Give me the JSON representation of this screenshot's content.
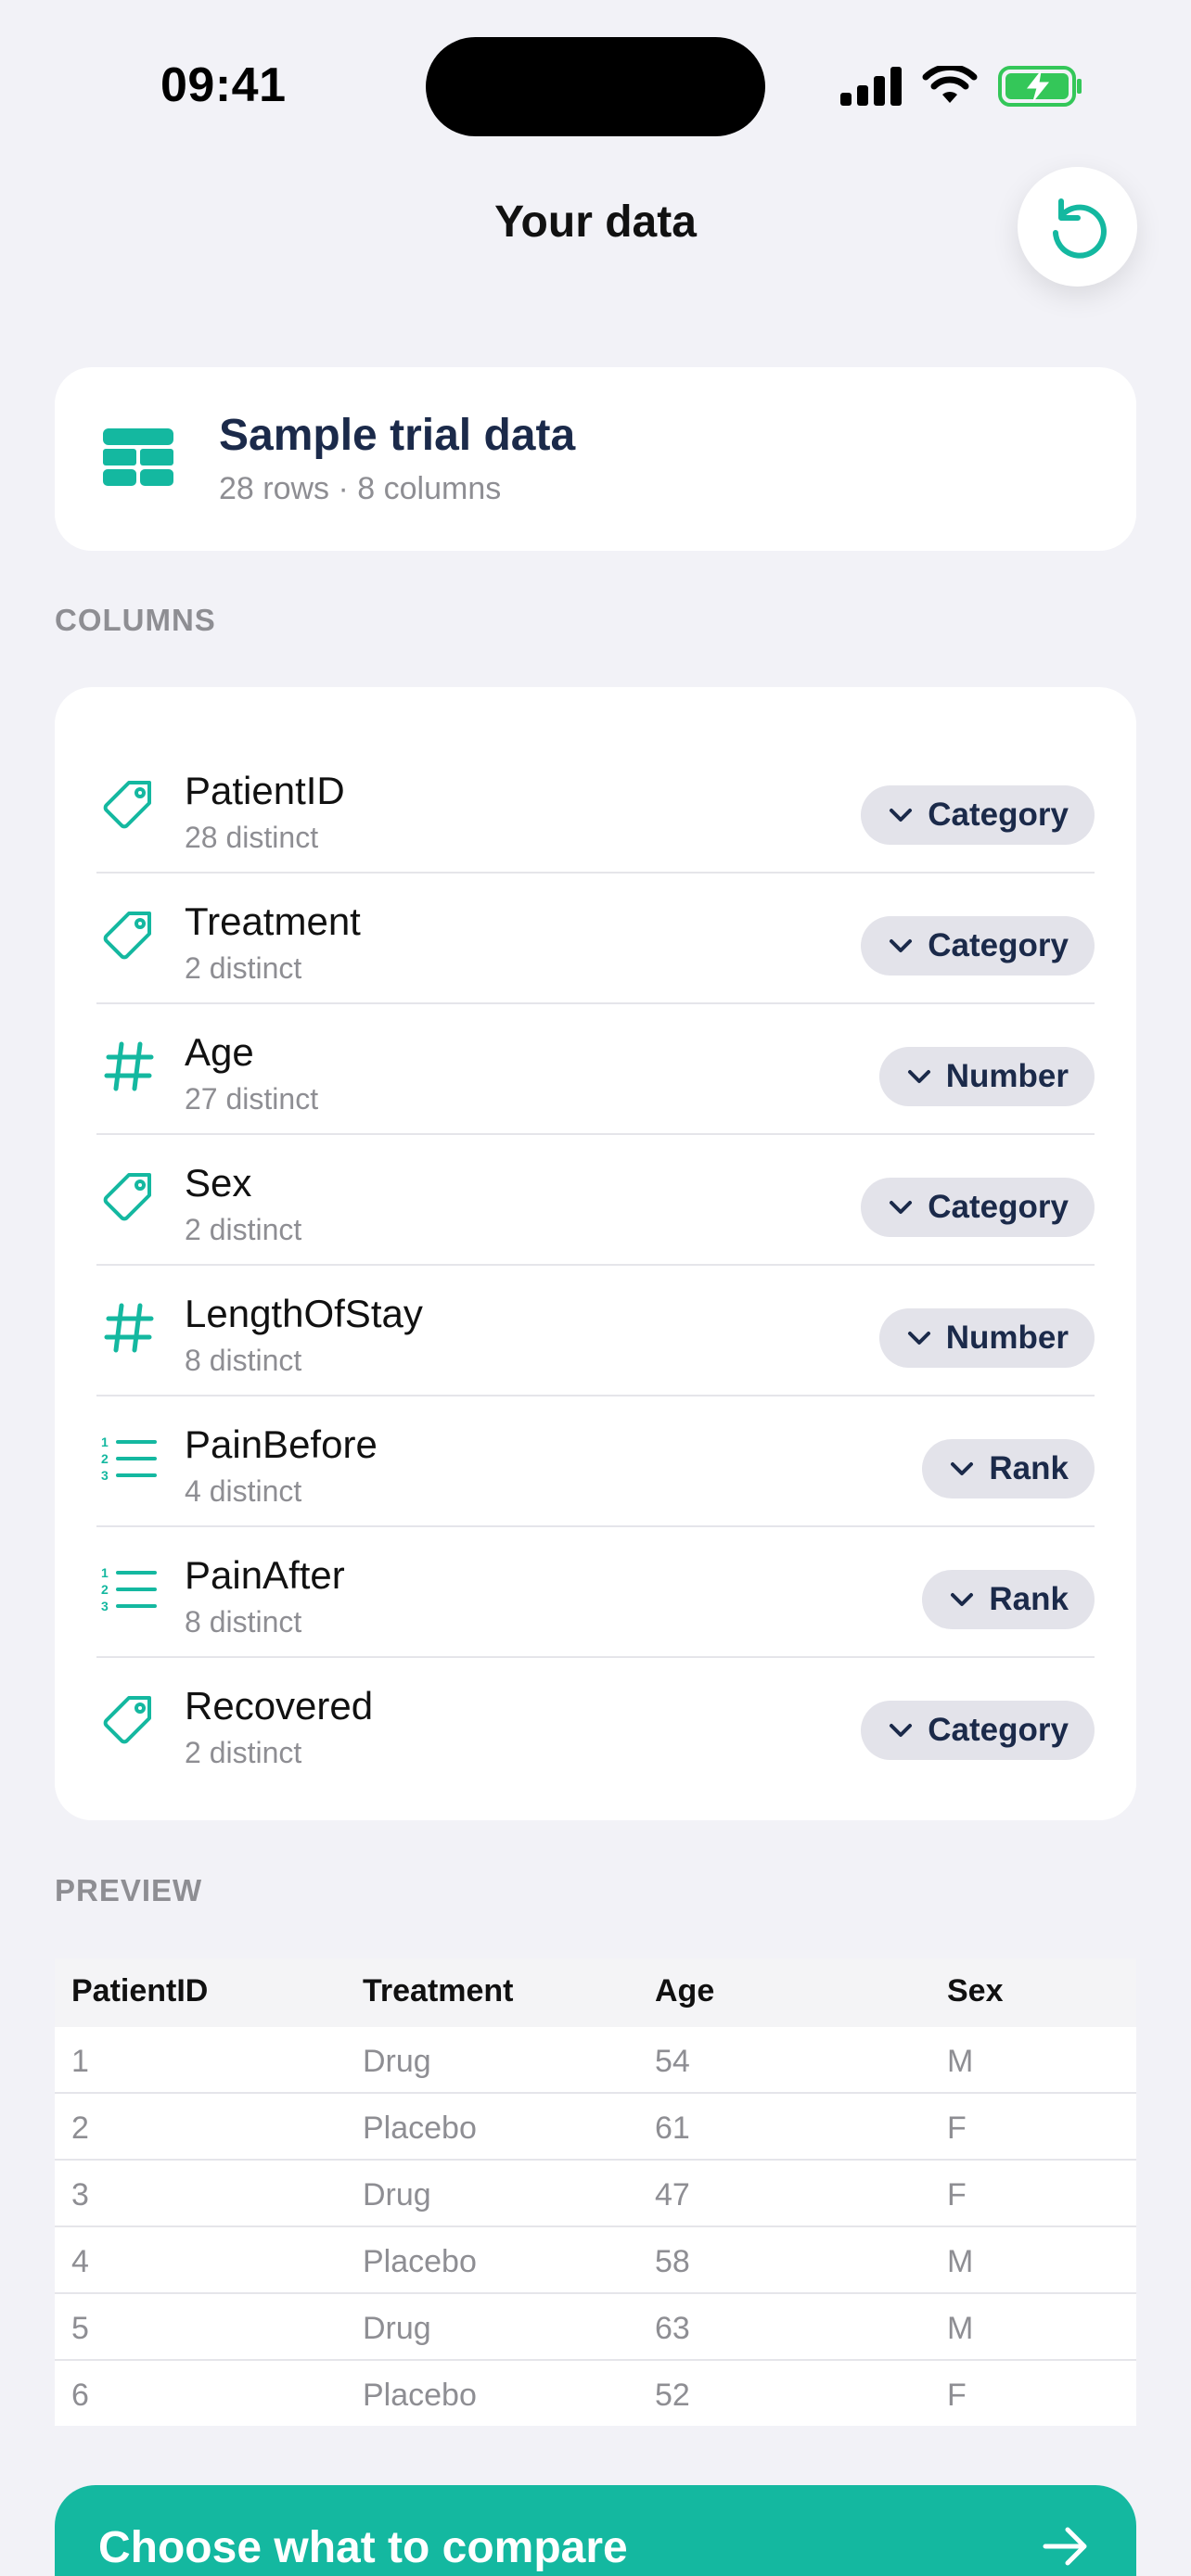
{
  "status_bar": {
    "time": "09:41"
  },
  "header": {
    "title": "Your data"
  },
  "dataset": {
    "title": "Sample trial data",
    "subtitle": "28 rows · 8 columns"
  },
  "sections": {
    "columns": "COLUMNS",
    "preview": "PREVIEW"
  },
  "columns": [
    {
      "name": "PatientID",
      "distinct": "28 distinct",
      "type": "Category",
      "icon": "tag-icon"
    },
    {
      "name": "Treatment",
      "distinct": "2 distinct",
      "type": "Category",
      "icon": "tag-icon"
    },
    {
      "name": "Age",
      "distinct": "27 distinct",
      "type": "Number",
      "icon": "hash-icon"
    },
    {
      "name": "Sex",
      "distinct": "2 distinct",
      "type": "Category",
      "icon": "tag-icon"
    },
    {
      "name": "LengthOfStay",
      "distinct": "8 distinct",
      "type": "Number",
      "icon": "hash-icon"
    },
    {
      "name": "PainBefore",
      "distinct": "4 distinct",
      "type": "Rank",
      "icon": "ordered-list-icon"
    },
    {
      "name": "PainAfter",
      "distinct": "8 distinct",
      "type": "Rank",
      "icon": "ordered-list-icon"
    },
    {
      "name": "Recovered",
      "distinct": "2 distinct",
      "type": "Category",
      "icon": "tag-icon"
    }
  ],
  "preview": {
    "headers": [
      "PatientID",
      "Treatment",
      "Age",
      "Sex"
    ],
    "rows": [
      [
        "1",
        "Drug",
        "54",
        "M"
      ],
      [
        "2",
        "Placebo",
        "61",
        "F"
      ],
      [
        "3",
        "Drug",
        "47",
        "F"
      ],
      [
        "4",
        "Placebo",
        "58",
        "M"
      ],
      [
        "5",
        "Drug",
        "63",
        "M"
      ],
      [
        "6",
        "Placebo",
        "52",
        "F"
      ]
    ]
  },
  "cta": {
    "label": "Choose what to compare"
  },
  "colors": {
    "accent": "#14b8a0",
    "navy": "#1b2a4a",
    "muted": "#8e8e93",
    "background": "#f2f2f7"
  }
}
